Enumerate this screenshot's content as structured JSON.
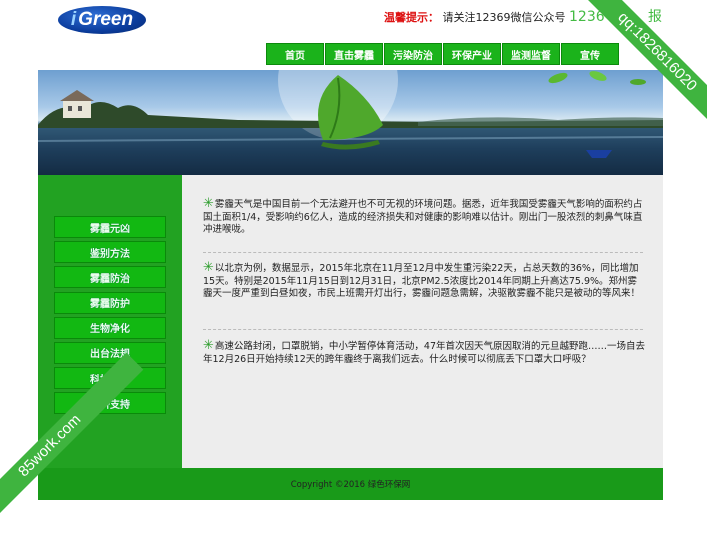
{
  "header": {
    "logo_text": "Green",
    "notice_label": "温馨提示：",
    "notice_text": "请关注12369微信公众号",
    "notice_trailing": "1236",
    "notice_trailing_end": "报"
  },
  "nav": {
    "items": [
      "首页",
      "直击雾霾",
      "污染防治",
      "环保产业",
      "监测监督",
      "宣传"
    ]
  },
  "sidebar": {
    "items": [
      "雾霾元凶",
      "鉴别方法",
      "雾霾防治",
      "雾霾防护",
      "生物净化",
      "出台法规",
      "科技治污",
      "经济支持"
    ]
  },
  "content": {
    "paragraphs": [
      "雾霾天气是中国目前一个无法避开也不可无视的环境问题。据悉，近年我国受雾霾天气影响的面积约占国土面积1/4，受影响约6亿人，造成的经济损失和对健康的影响难以估计。刚出门一股浓烈的刺鼻气味直冲进喉咙。",
      "以北京为例，数据显示，2015年北京在11月至12月中发生重污染22天，占总天数的36%，同比增加15天。特别是2015年11月15日到12月31日，北京PM2.5浓度比2014年同期上升高达75.9%。郑州雾霾天一度严重到白昼如夜，市民上班需开灯出行，雾霾问题急需解，决驱散雾霾不能只是被动的等风来！",
      "高速公路封闭，口罩脱销，中小学暂停体育活动，47年首次因天气原因取消的元旦越野跑……一场自去年12月26日开始持续12天的跨年霾终于离我们远去。什么时候可以彻底丢下口罩大口呼吸？"
    ]
  },
  "footer": {
    "copyright": "Copyright ©2016 绿色环保网"
  },
  "watermark": {
    "top_right": "qq:1826816020",
    "bottom_left": "85work.com"
  }
}
